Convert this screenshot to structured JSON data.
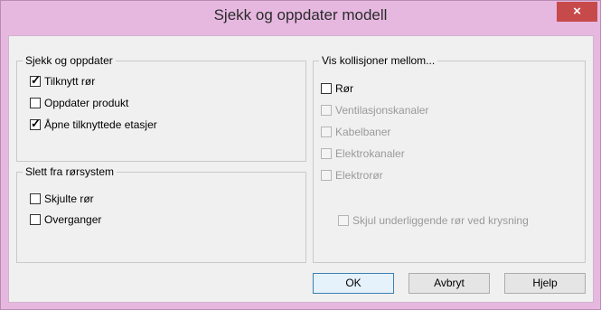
{
  "window": {
    "title": "Sjekk og oppdater modell",
    "close_label": "×"
  },
  "left_top_group": {
    "title": "Sjekk og oppdater",
    "items": [
      {
        "label": "Tilknytt rør",
        "checked": true,
        "enabled": true
      },
      {
        "label": "Oppdater produkt",
        "checked": false,
        "enabled": true
      },
      {
        "label": "Åpne tilknyttede etasjer",
        "checked": true,
        "enabled": true
      }
    ]
  },
  "left_bottom_group": {
    "title": "Slett fra rørsystem",
    "items": [
      {
        "label": "Skjulte rør",
        "checked": false,
        "enabled": true
      },
      {
        "label": "Overganger",
        "checked": false,
        "enabled": true
      }
    ]
  },
  "right_group": {
    "title": "Vis kollisjoner mellom...",
    "items": [
      {
        "label": "Rør",
        "checked": false,
        "enabled": true
      },
      {
        "label": "Ventilasjonskanaler",
        "checked": false,
        "enabled": false
      },
      {
        "label": "Kabelbaner",
        "checked": false,
        "enabled": false
      },
      {
        "label": "Elektrokanaler",
        "checked": false,
        "enabled": false
      },
      {
        "label": "Elektrorør",
        "checked": false,
        "enabled": false
      }
    ],
    "hide_option": {
      "label": "Skjul underliggende rør ved krysning",
      "checked": false,
      "enabled": false
    }
  },
  "buttons": {
    "ok": "OK",
    "cancel": "Avbryt",
    "help": "Hjelp"
  },
  "colors": {
    "titlebar": "#e6b8e0",
    "close_button": "#c74a4a",
    "dialog_background": "#f0f0f0"
  }
}
